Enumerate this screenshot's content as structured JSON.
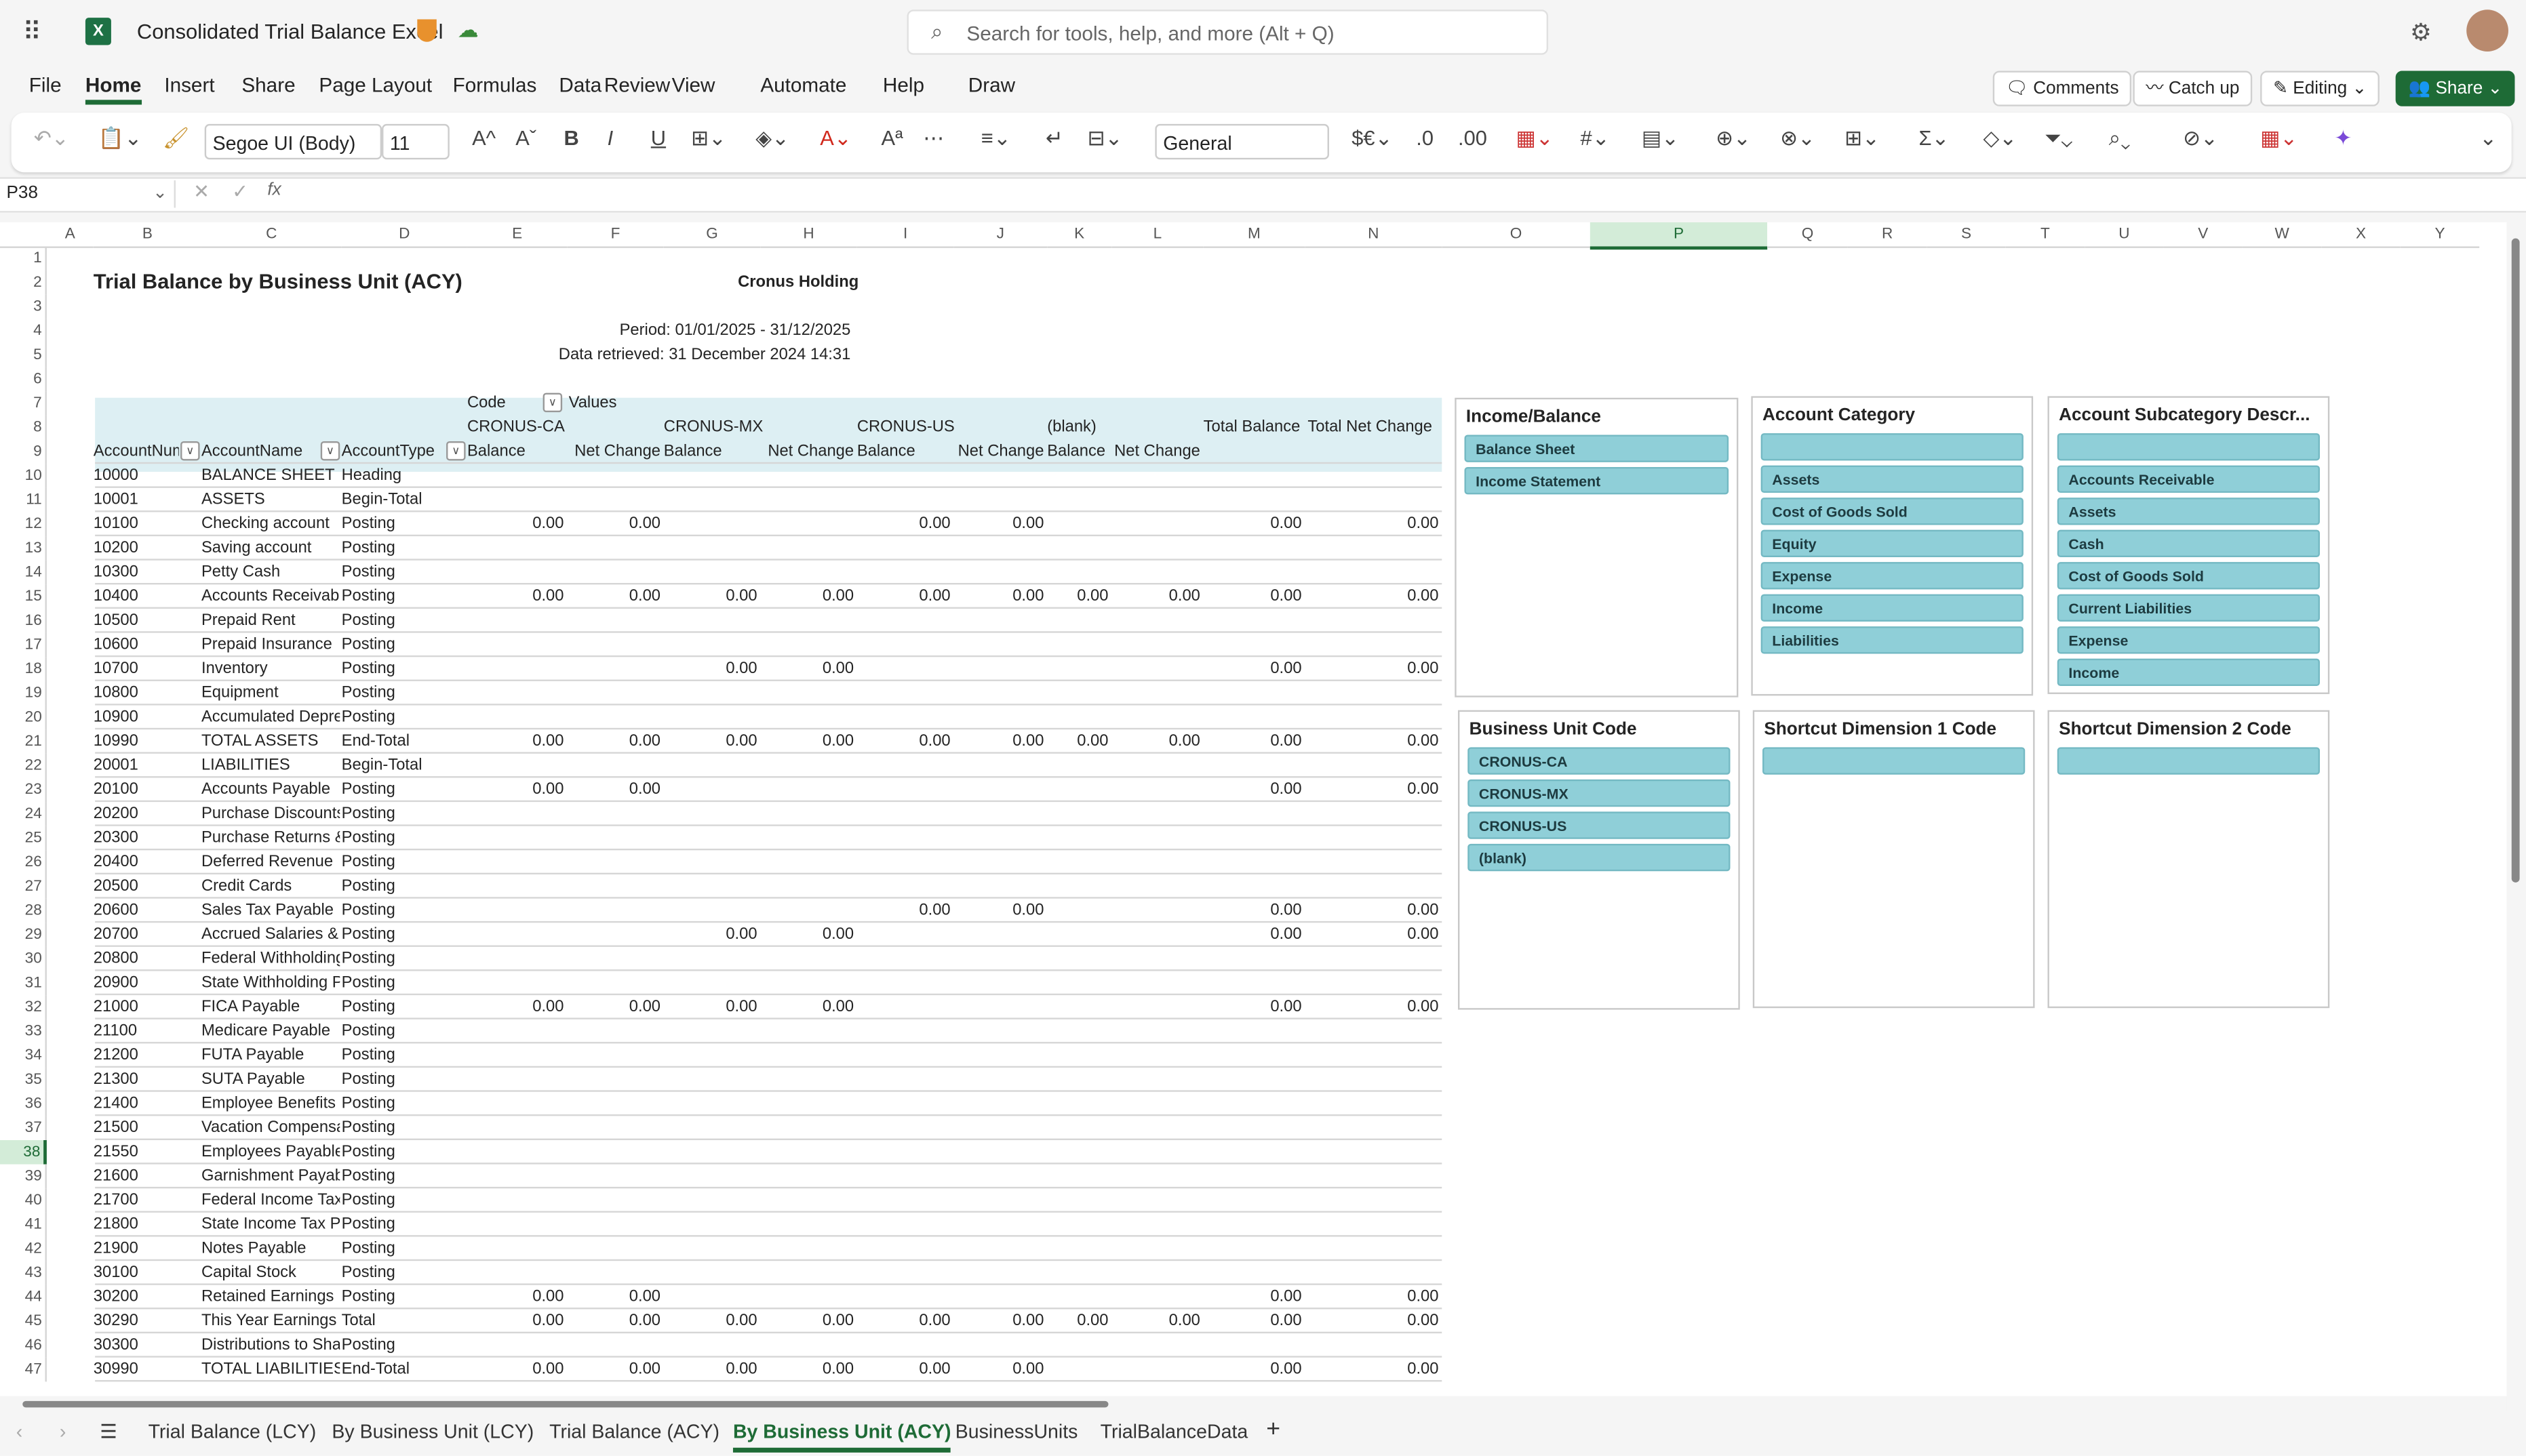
{
  "app": {
    "title": "Consolidated Trial Balance Excel",
    "search_placeholder": "Search for tools, help, and more (Alt + Q)",
    "icons": [
      "app-launcher-icon",
      "excel-logo-icon",
      "sensitivity-shield-icon",
      "cloud-saved-icon",
      "settings-icon",
      "avatar"
    ]
  },
  "menu": {
    "items": [
      "File",
      "Home",
      "Insert",
      "Share",
      "Page Layout",
      "Formulas",
      "Data",
      "Review",
      "View",
      "Automate",
      "Help",
      "Draw"
    ],
    "active": "Home",
    "comments": "Comments",
    "catch_up": "Catch up",
    "editing": "Editing",
    "share": "Share"
  },
  "ribbon": {
    "font": "Segoe UI (Body)",
    "size": "11",
    "number_format": "General",
    "currency": "$€"
  },
  "formula_bar": {
    "name_box": "P38",
    "formula": ""
  },
  "colors": {
    "accent": "#1e6b36",
    "slicer_button": "#8fcfd8",
    "pivot_header": "#ddeff3"
  },
  "sheet": {
    "columns": [
      "A",
      "B",
      "C",
      "D",
      "E",
      "F",
      "G",
      "H",
      "I",
      "J",
      "K",
      "L",
      "M",
      "N",
      "O",
      "P",
      "Q",
      "R",
      "S",
      "T",
      "U",
      "V",
      "W",
      "X",
      "Y"
    ],
    "selected_column": "P",
    "selected_row": 38,
    "report_title": "Trial Balance by Business Unit (ACY)",
    "company": "Cronus Holding",
    "period": "Period: 01/01/2025 - 31/12/2025",
    "retrieved": "Data retrieved: 31 December 2024 14:31",
    "pivot": {
      "code_label": "Code",
      "values_label": "Values",
      "units": [
        "CRONUS-CA",
        "CRONUS-MX",
        "CRONUS-US",
        "(blank)",
        "Total Balance",
        "Total Net Change"
      ],
      "sub_headers": [
        "Balance",
        "Net Change",
        "Balance",
        "Net Change",
        "Balance",
        "Net Change",
        "Balance",
        "Net Change"
      ],
      "row_headers": [
        "AccountNumber",
        "AccountName",
        "AccountType"
      ],
      "rows": [
        [
          "10000",
          "BALANCE SHEET",
          "Heading",
          []
        ],
        [
          "10001",
          "ASSETS",
          "Begin-Total",
          []
        ],
        [
          "10100",
          "Checking account",
          "Posting",
          [
            0,
            1,
            4,
            5,
            8,
            9
          ]
        ],
        [
          "10200",
          "Saving account",
          "Posting",
          []
        ],
        [
          "10300",
          "Petty Cash",
          "Posting",
          []
        ],
        [
          "10400",
          "Accounts Receivable",
          "Posting",
          [
            0,
            1,
            2,
            3,
            4,
            5,
            6,
            7,
            8,
            9
          ]
        ],
        [
          "10500",
          "Prepaid Rent",
          "Posting",
          []
        ],
        [
          "10600",
          "Prepaid Insurance",
          "Posting",
          []
        ],
        [
          "10700",
          "Inventory",
          "Posting",
          [
            2,
            3,
            8,
            9
          ]
        ],
        [
          "10800",
          "Equipment",
          "Posting",
          []
        ],
        [
          "10900",
          "Accumulated Depreciation",
          "Posting",
          []
        ],
        [
          "10990",
          "TOTAL ASSETS",
          "End-Total",
          [
            0,
            1,
            2,
            3,
            4,
            5,
            6,
            7,
            8,
            9
          ]
        ],
        [
          "20001",
          "LIABILITIES",
          "Begin-Total",
          []
        ],
        [
          "20100",
          "Accounts Payable",
          "Posting",
          [
            0,
            1,
            8,
            9
          ]
        ],
        [
          "20200",
          "Purchase Discounts",
          "Posting",
          []
        ],
        [
          "20300",
          "Purchase Returns & Allowances",
          "Posting",
          []
        ],
        [
          "20400",
          "Deferred Revenue",
          "Posting",
          []
        ],
        [
          "20500",
          "Credit Cards",
          "Posting",
          []
        ],
        [
          "20600",
          "Sales Tax Payable",
          "Posting",
          [
            4,
            5,
            8,
            9
          ]
        ],
        [
          "20700",
          "Accrued Salaries & Wages",
          "Posting",
          [
            2,
            3,
            8,
            9
          ]
        ],
        [
          "20800",
          "Federal Withholding Payable",
          "Posting",
          []
        ],
        [
          "20900",
          "State Withholding Payable",
          "Posting",
          []
        ],
        [
          "21000",
          "FICA Payable",
          "Posting",
          [
            0,
            1,
            2,
            3,
            8,
            9
          ]
        ],
        [
          "21100",
          "Medicare Payable",
          "Posting",
          []
        ],
        [
          "21200",
          "FUTA Payable",
          "Posting",
          []
        ],
        [
          "21300",
          "SUTA Payable",
          "Posting",
          []
        ],
        [
          "21400",
          "Employee Benefits Payable",
          "Posting",
          []
        ],
        [
          "21500",
          "Vacation Compensation Payable",
          "Posting",
          []
        ],
        [
          "21550",
          "Employees Payable",
          "Posting",
          []
        ],
        [
          "21600",
          "Garnishment Payable",
          "Posting",
          []
        ],
        [
          "21700",
          "Federal Income Taxes Payable",
          "Posting",
          []
        ],
        [
          "21800",
          "State Income Tax Payable",
          "Posting",
          []
        ],
        [
          "21900",
          "Notes Payable",
          "Posting",
          []
        ],
        [
          "30100",
          "Capital Stock",
          "Posting",
          []
        ],
        [
          "30200",
          "Retained Earnings",
          "Posting",
          [
            0,
            1,
            8,
            9
          ]
        ],
        [
          "30290",
          "This Year Earnings",
          "Total",
          [
            0,
            1,
            2,
            3,
            4,
            5,
            6,
            7,
            8,
            9
          ]
        ],
        [
          "30300",
          "Distributions to Shareholders",
          "Posting",
          []
        ],
        [
          "30990",
          "TOTAL LIABILITIES",
          "End-Total",
          [
            0,
            1,
            2,
            3,
            4,
            5,
            8,
            9
          ]
        ]
      ],
      "cell_value": "0.00"
    }
  },
  "slicers": [
    {
      "title": "Income/Balance",
      "items": [
        "Balance Sheet",
        "Income Statement"
      ]
    },
    {
      "title": "Account Category",
      "items": [
        "",
        "Assets",
        "Cost of Goods Sold",
        "Equity",
        "Expense",
        "Income",
        "Liabilities"
      ]
    },
    {
      "title": "Account Subcategory Descr...",
      "items": [
        "",
        "Accounts Receivable",
        "Assets",
        "Cash",
        "Cost of Goods Sold",
        "Current Liabilities",
        "Expense",
        "Income"
      ]
    },
    {
      "title": "Business Unit Code",
      "items": [
        "CRONUS-CA",
        "CRONUS-MX",
        "CRONUS-US",
        "(blank)"
      ]
    },
    {
      "title": "Shortcut Dimension 1 Code",
      "items": [
        ""
      ]
    },
    {
      "title": "Shortcut Dimension 2 Code",
      "items": [
        ""
      ]
    }
  ],
  "sheet_tabs": {
    "items": [
      "Trial Balance (LCY)",
      "By Business Unit (LCY)",
      "Trial Balance (ACY)",
      "By Business Unit (ACY)",
      "BusinessUnits",
      "TrialBalanceData"
    ],
    "active": "By Business Unit (ACY)"
  }
}
